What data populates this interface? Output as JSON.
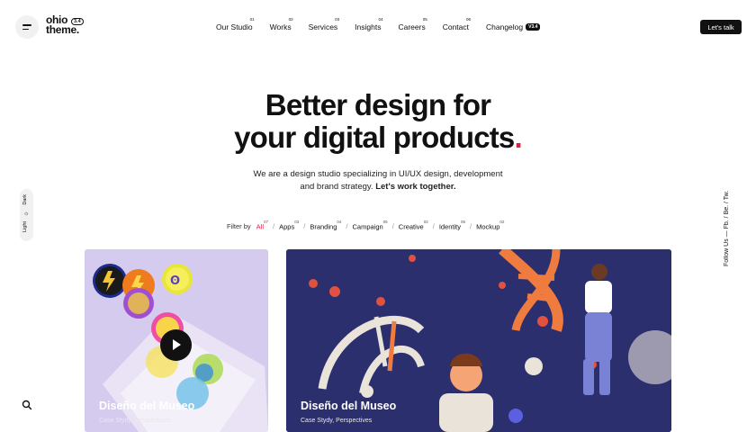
{
  "header": {
    "logo_line1": "ohio",
    "logo_line2": "theme.",
    "logo_version": "3.4",
    "nav": [
      {
        "label": "Our Studio",
        "num": "01"
      },
      {
        "label": "Works",
        "num": "02"
      },
      {
        "label": "Services",
        "num": "03"
      },
      {
        "label": "Insights",
        "num": "04"
      },
      {
        "label": "Careers",
        "num": "05"
      },
      {
        "label": "Contact",
        "num": "06"
      }
    ],
    "changelog_label": "Changelog",
    "changelog_badge": "V3.4",
    "cta_label": "Let's talk"
  },
  "hero": {
    "title_line1": "Better design for",
    "title_line2": "your digital products",
    "title_dot": ".",
    "subtitle_line1": "We are a design studio specializing in UI/UX design, development",
    "subtitle_line2": "and brand strategy.",
    "subtitle_bold": "Let's work together."
  },
  "filters": {
    "label": "Filter by",
    "items": [
      {
        "label": "All",
        "count": "07",
        "active": true
      },
      {
        "label": "Apps",
        "count": "03"
      },
      {
        "label": "Branding",
        "count": "04"
      },
      {
        "label": "Campaign",
        "count": "06"
      },
      {
        "label": "Creative",
        "count": "02"
      },
      {
        "label": "Identity",
        "count": "05"
      },
      {
        "label": "Mockup",
        "count": "02"
      }
    ]
  },
  "sidebar": {
    "theme_dark": "Dark",
    "theme_light": "Light",
    "follow": "Follow Us — Fb. / Be. / Tw."
  },
  "cards": [
    {
      "title": "Diseño del Museo",
      "meta": "Case Stydy, Perspectives",
      "bg_color": "#d8cff0"
    },
    {
      "title": "Diseño del Museo",
      "meta": "Case Stydy, Perspectives",
      "bg_color": "#2a2f6b"
    }
  ],
  "colors": {
    "accent": "#e11d48",
    "text": "#111111"
  }
}
